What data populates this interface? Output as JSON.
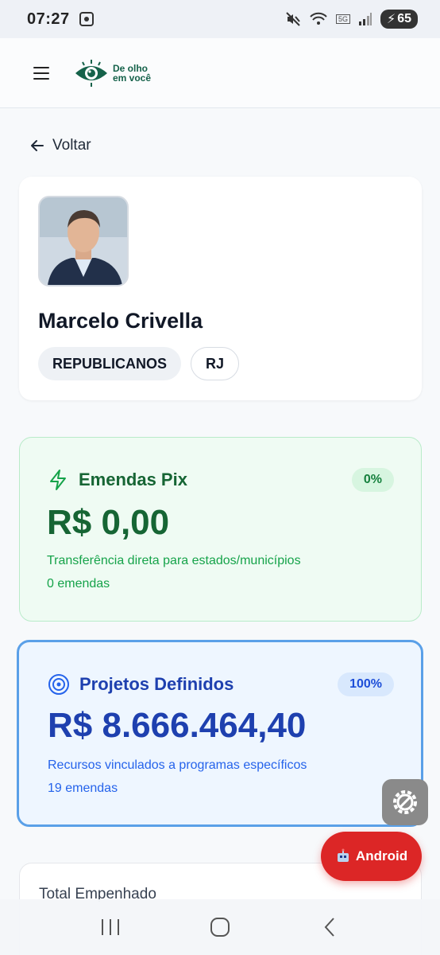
{
  "status_bar": {
    "time": "07:27",
    "network": "5G",
    "battery": "65",
    "wifi_sub": "5"
  },
  "header": {
    "logo_line1": "De olho",
    "logo_line2": "em você"
  },
  "back": {
    "label": "Voltar"
  },
  "profile": {
    "name": "Marcelo Crivella",
    "party": "REPUBLICANOS",
    "state": "RJ"
  },
  "pix": {
    "title": "Emendas Pix",
    "percent": "0%",
    "amount": "R$ 0,00",
    "description": "Transferência direta para estados/municípios",
    "count": "0 emendas",
    "accent": "#166534"
  },
  "projects": {
    "title": "Projetos Definidos",
    "percent": "100%",
    "amount": "R$ 8.666.464,40",
    "description": "Recursos vinculados a programas específicos",
    "count": "19 emendas",
    "accent": "#1e40af"
  },
  "total": {
    "label": "Total Empenhado"
  },
  "android_button": {
    "label": "Android",
    "color": "#dc2626"
  },
  "icons": {
    "menu": "hamburger-icon",
    "back": "arrow-left-icon",
    "pix": "lightning-icon",
    "projects": "target-icon",
    "settings": "gear-wrench-icon",
    "android": "robot-icon"
  }
}
